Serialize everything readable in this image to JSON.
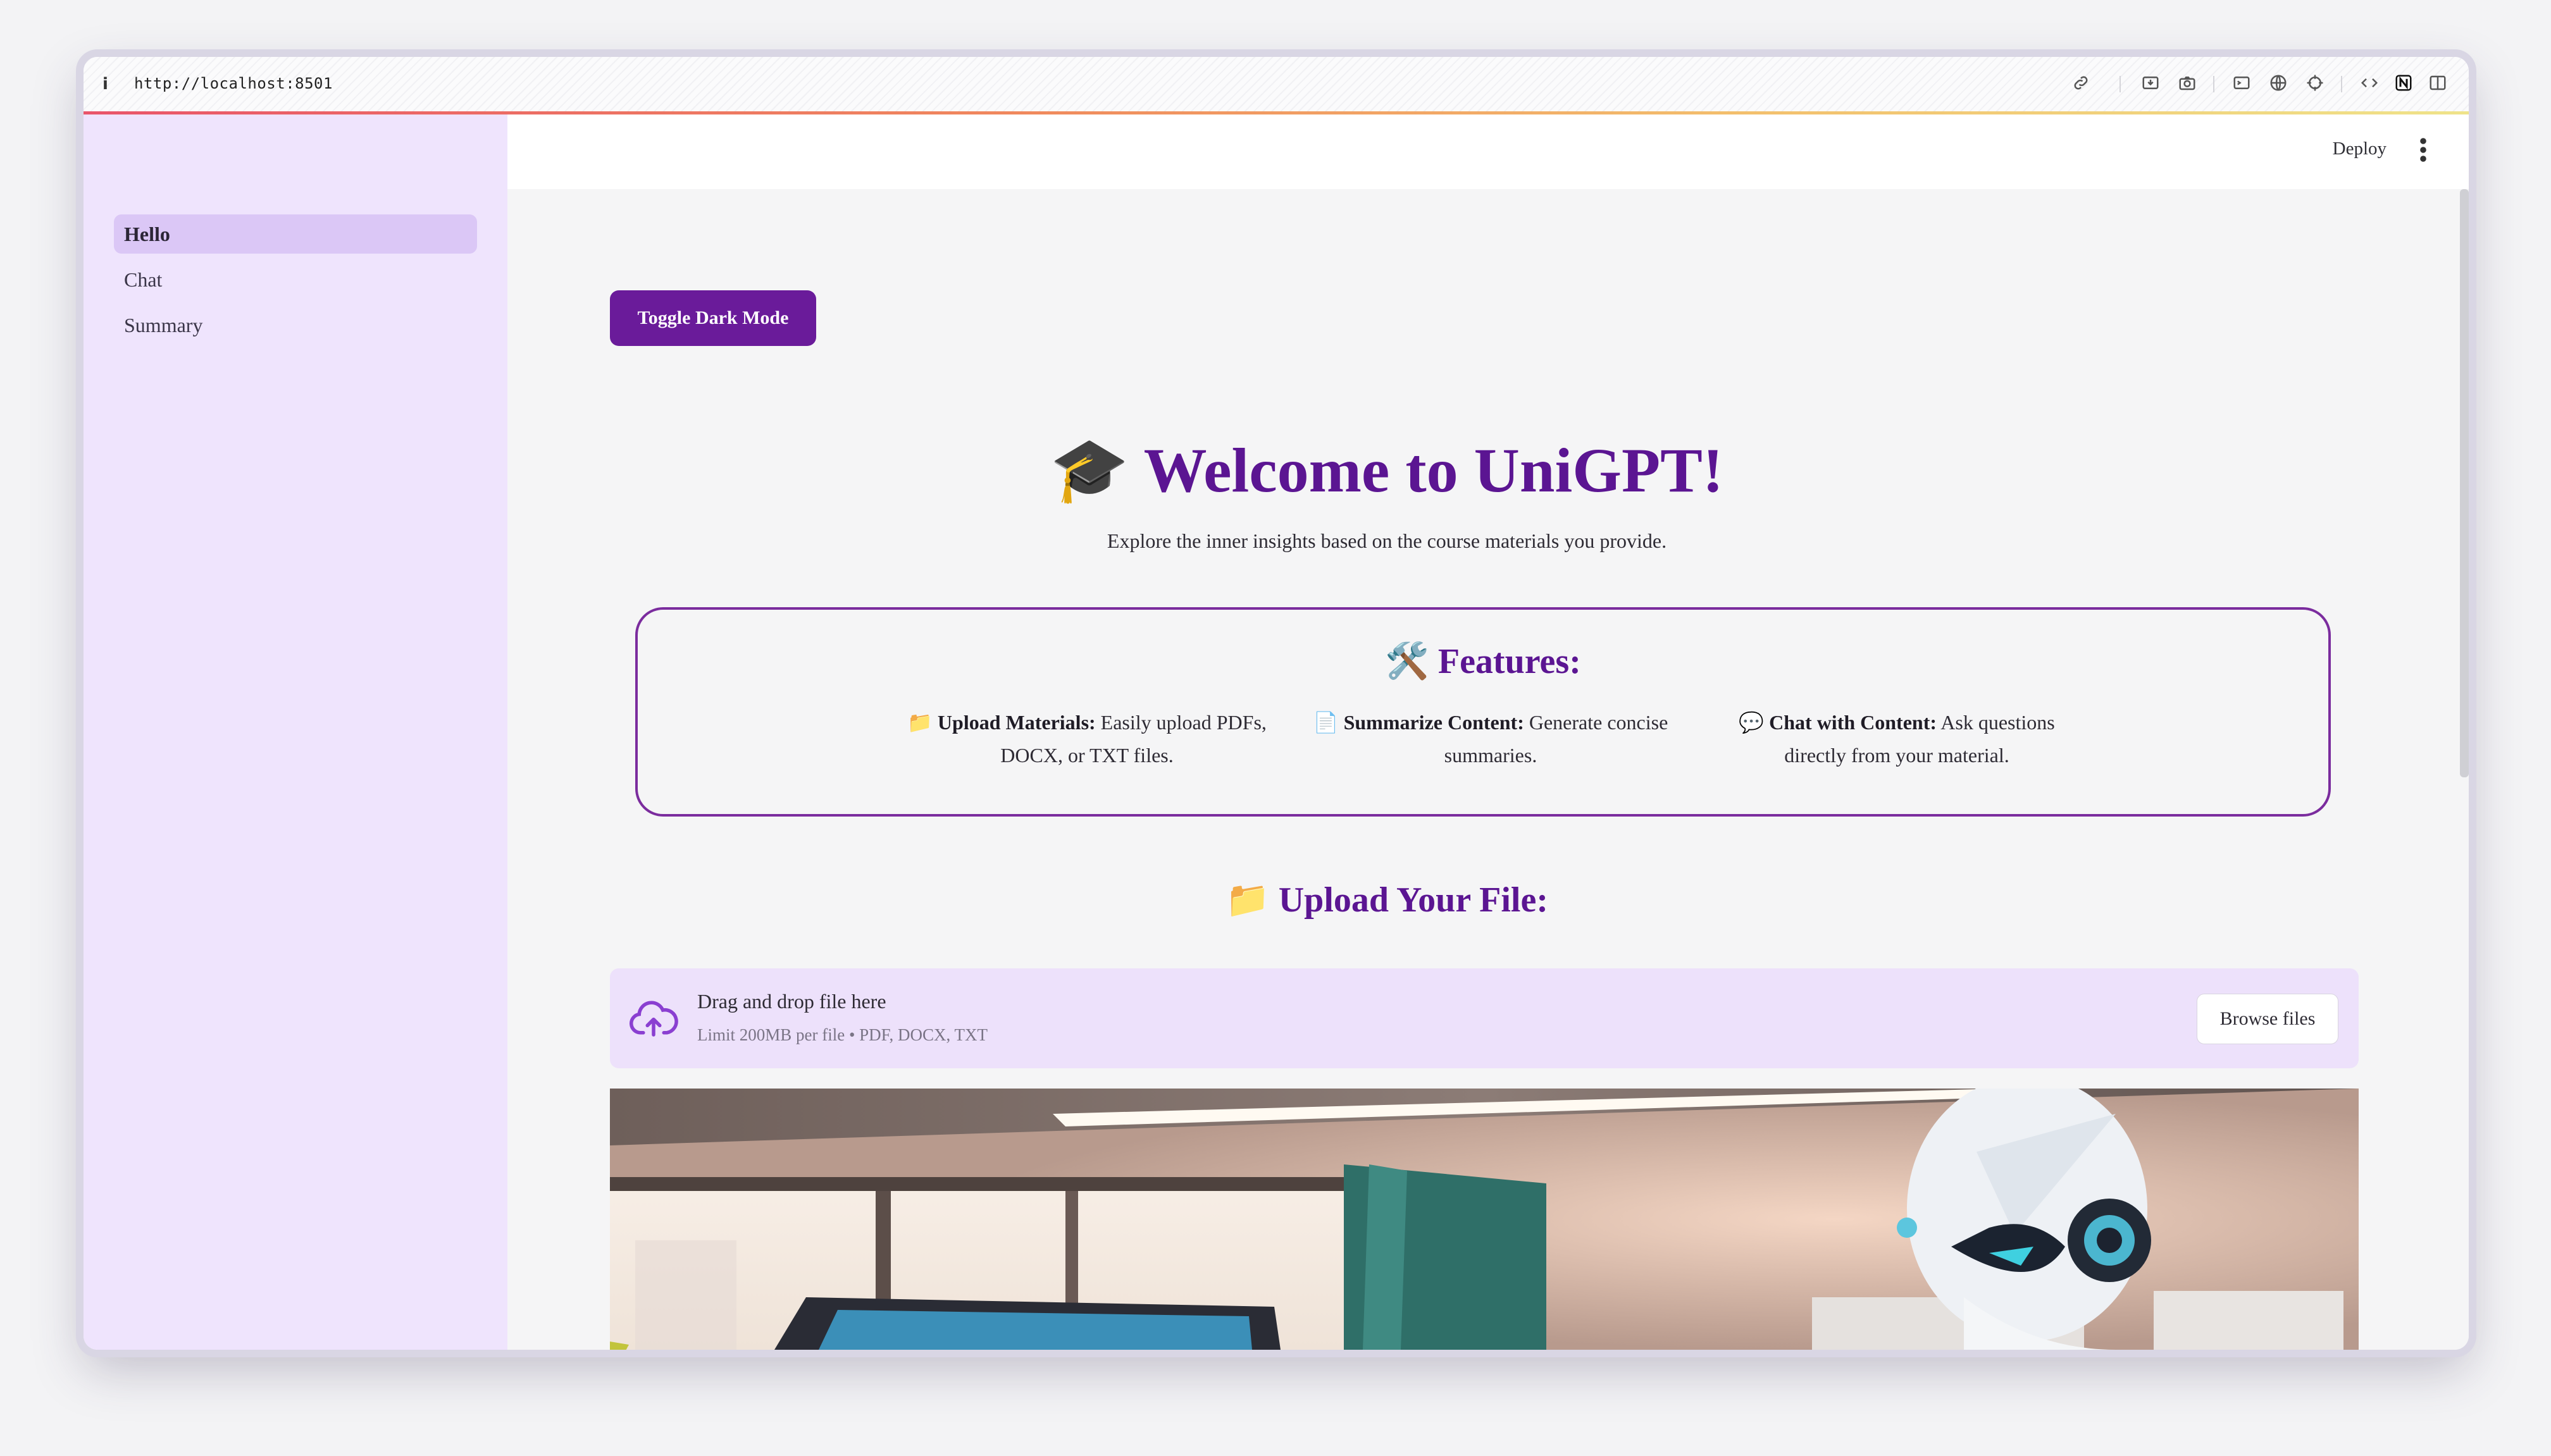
{
  "browser": {
    "info_icon": "i",
    "url": "http://localhost:8501",
    "toolbar_icons": [
      "link-icon",
      "download-icon",
      "camera-icon",
      "terminal-icon",
      "globe-icon",
      "crosshair-icon",
      "code-icon",
      "notion-icon",
      "split-view-icon"
    ]
  },
  "header": {
    "deploy_label": "Deploy",
    "menu_icon": "kebab-menu-icon"
  },
  "sidebar": {
    "items": [
      {
        "label": "Hello"
      },
      {
        "label": "Chat"
      },
      {
        "label": "Summary"
      }
    ]
  },
  "main": {
    "toggle_label": "Toggle Dark Mode",
    "welcome_emoji": "🎓",
    "welcome_title": "Welcome to UniGPT!",
    "subtitle": "Explore the inner insights based on the course materials you provide.",
    "features": {
      "emoji": "🛠️",
      "title": "Features:",
      "items": [
        {
          "emoji": "📁",
          "name": "Upload Materials:",
          "text_line1": "Easily upload PDFs,",
          "text_line2": "DOCX, or TXT files."
        },
        {
          "emoji": "📄",
          "name": "Summarize Content:",
          "text_line1": "Generate concise",
          "text_line2": "summaries."
        },
        {
          "emoji": "💬",
          "name": "Chat with Content:",
          "text_line1": "Ask questions",
          "text_line2": "directly from your material."
        }
      ]
    },
    "upload": {
      "emoji": "📁",
      "title": "Upload Your File:",
      "drop_title": "Drag and drop file here",
      "drop_sub": "Limit 200MB per file • PDF, DOCX, TXT",
      "browse_label": "Browse files"
    }
  },
  "colors": {
    "accent": "#6a1b9a",
    "title": "#5b1592",
    "sidebar_bg": "#efe4fd",
    "active_item": "#dbc7f6",
    "dropzone_bg": "#ede1fb"
  }
}
